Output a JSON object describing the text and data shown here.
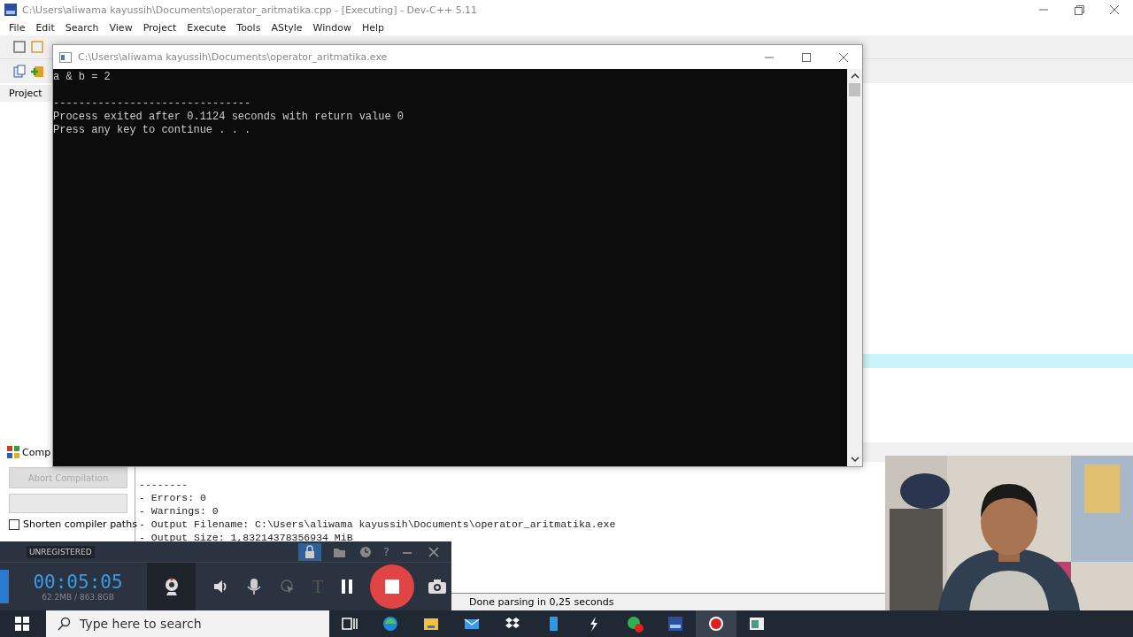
{
  "ide": {
    "title": "C:\\Users\\aliwama kayussih\\Documents\\operator_aritmatika.cpp - [Executing] - Dev-C++ 5.11",
    "menu": [
      "File",
      "Edit",
      "Search",
      "View",
      "Project",
      "Execute",
      "Tools",
      "AStyle",
      "Window",
      "Help"
    ],
    "project_tab": "Project",
    "bottom_panel": {
      "tab": "Comp",
      "abort_button": {
        "label": "Abort Compilation",
        "disabled": true
      },
      "shorten_paths": {
        "label": "Shorten compiler paths",
        "checked": false
      },
      "log": [
        "--------",
        "- Errors: 0",
        "- Warnings: 0",
        "- Output Filename: C:\\Users\\aliwama kayussih\\Documents\\operator_aritmatika.exe",
        "- Output Size: 1,83214378356934 MiB"
      ]
    },
    "status": "Done parsing in 0,25 seconds"
  },
  "console": {
    "title": "C:\\Users\\aliwama kayussih\\Documents\\operator_aritmatika.exe",
    "lines": [
      {
        "text": "a & b = 2",
        "gap_after": true
      },
      {
        "text": "-------------------------------",
        "gap_after": false
      },
      {
        "text": "Process exited after 0.1124 seconds with return value 0",
        "gap_after": false
      },
      {
        "text": "Press any key to continue . . .",
        "gap_after": false
      }
    ]
  },
  "recorder": {
    "badge": "UNREGISTERED",
    "help": "?",
    "timer": "00:05:05",
    "storage": "62.2MB / 863.8GB",
    "text_tool": "T"
  },
  "taskbar": {
    "search": {
      "placeholder": "Type here to search"
    }
  }
}
